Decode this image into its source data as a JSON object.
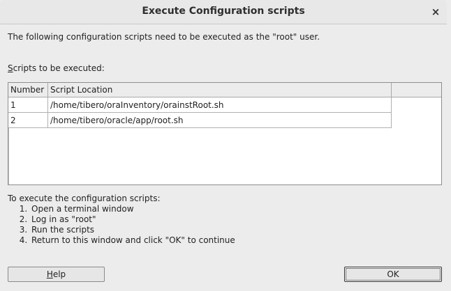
{
  "window": {
    "title": "Execute Configuration scripts",
    "close_glyph": "×"
  },
  "intro_text": "The following configuration scripts need to be executed as the \"root\" user.",
  "scripts_label": {
    "accel": "S",
    "rest": "cripts to be executed:"
  },
  "table": {
    "headers": [
      "Number",
      "Script Location"
    ],
    "rows": [
      {
        "number": "1",
        "location": "/home/tibero/oraInventory/orainstRoot.sh"
      },
      {
        "number": "2",
        "location": "/home/tibero/oracle/app/root.sh"
      }
    ]
  },
  "instructions": {
    "heading": "To execute the configuration scripts:",
    "steps": [
      "Open a terminal window",
      "Log in as \"root\"",
      "Run the scripts",
      "Return to this window and click \"OK\" to continue"
    ]
  },
  "buttons": {
    "help": {
      "accel": "H",
      "rest": "elp"
    },
    "ok": "OK"
  }
}
